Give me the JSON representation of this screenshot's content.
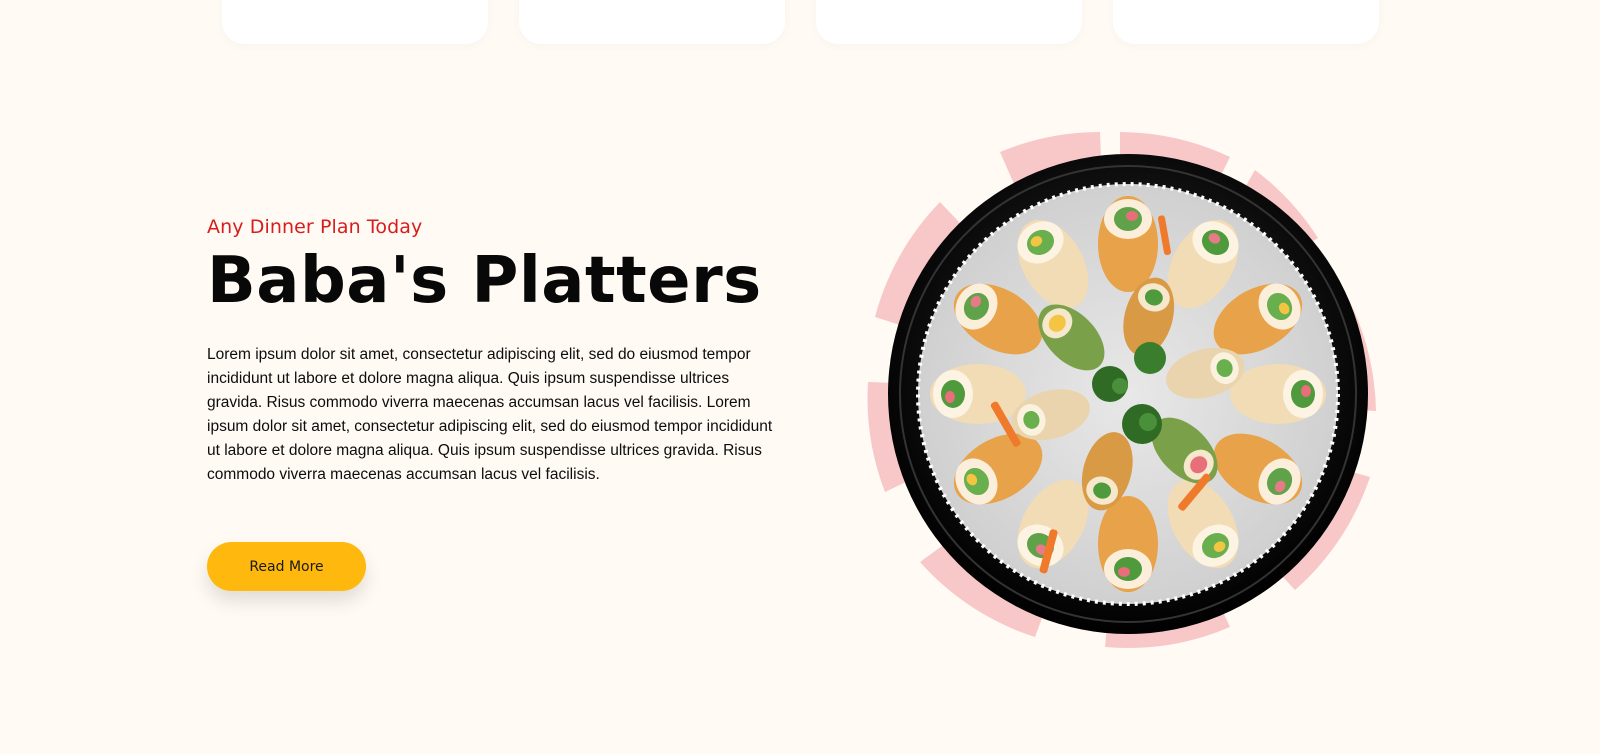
{
  "hero": {
    "eyebrow": "Any Dinner Plan Today",
    "title": "Baba's Platters",
    "description": "Lorem ipsum dolor sit amet, consectetur adipiscing elit, sed do eiusmod tempor incididunt ut labore et dolore magna aliqua. Quis ipsum suspendisse ultrices gravida. Risus commodo viverra maecenas accumsan lacus vel facilisis. Lorem ipsum dolor sit amet, consectetur adipiscing elit, sed do eiusmod tempor incididunt ut labore et dolore magna aliqua. Quis ipsum suspendisse ultrices gravida. Risus commodo viverra maecenas accumsan lacus vel facilisis.",
    "button_label": "Read More"
  },
  "colors": {
    "background": "#fffaf4",
    "eyebrow": "#d81d1d",
    "button": "#ffb80d",
    "accent_pink": "#f8c8c8",
    "platter": "#111111"
  },
  "image": {
    "description": "Wrap sandwich platter"
  }
}
